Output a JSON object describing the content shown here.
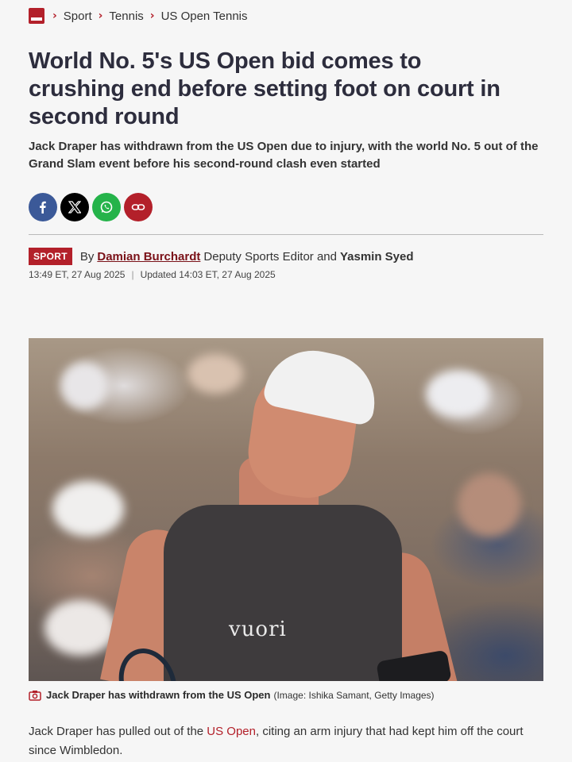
{
  "breadcrumb": {
    "items": [
      "Sport",
      "Tennis",
      "US Open Tennis"
    ]
  },
  "headline": "World No. 5's US Open bid comes to crushing end before setting foot on court in second round",
  "standfirst": "Jack Draper has withdrawn from the US Open due to injury, with the world No. 5 out of the Grand Slam event before his second-round clash even started",
  "share": {
    "icons": [
      "facebook-icon",
      "x-icon",
      "whatsapp-icon",
      "link-icon"
    ]
  },
  "byline": {
    "tag": "SPORT",
    "by": "By",
    "author1": "Damian Burchardt",
    "role1": "Deputy Sports Editor and",
    "author2": "Yasmin Syed",
    "published": "13:49 ET, 27 Aug 2025",
    "separator": "|",
    "updated": "Updated 14:03 ET, 27 Aug 2025"
  },
  "photo": {
    "shirt_brand": "vuori"
  },
  "caption": {
    "text": "Jack Draper has withdrawn from the US Open",
    "credit": "(Image: Ishika Samant, Getty Images)"
  },
  "body": {
    "before_link": "Jack Draper has pulled out of the ",
    "link": "US Open",
    "after_link": ", citing an arm injury that had kept him off the court since Wimbledon."
  },
  "colors": {
    "accent": "#b3202a",
    "facebook": "#3b5998",
    "x": "#000000",
    "whatsapp": "#25b34a"
  }
}
